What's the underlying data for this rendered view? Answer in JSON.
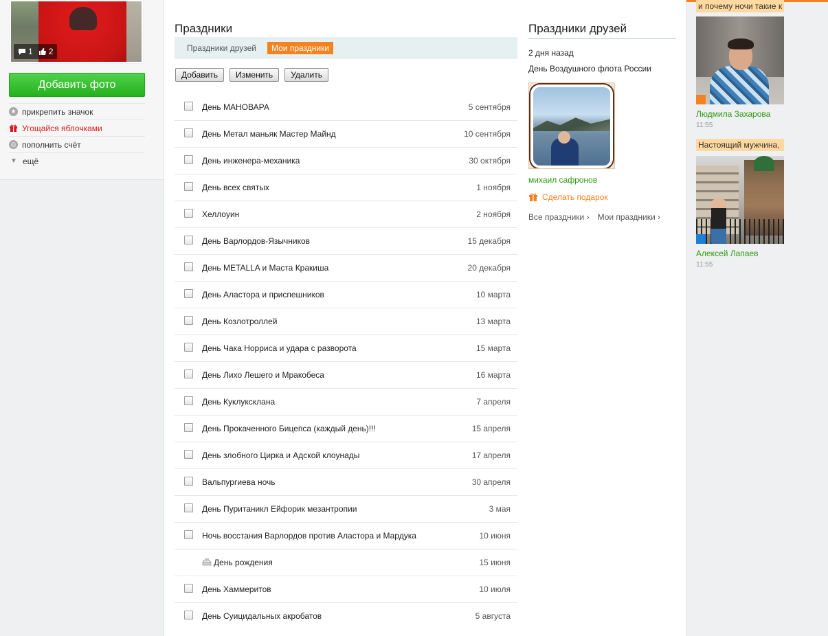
{
  "left": {
    "stats": {
      "comments": "1",
      "likes": "2"
    },
    "add_photo": "Добавить фото",
    "menu": [
      {
        "label": "прикрепить значок",
        "icon": "star-icon"
      },
      {
        "label": "Угощайся яблочками",
        "icon": "gift-icon",
        "color": "#d81a1a"
      },
      {
        "label": "пополнить счёт",
        "icon": "coins-icon"
      },
      {
        "label": "ещё",
        "icon": "triangle-down-icon"
      }
    ]
  },
  "holidays": {
    "title": "Праздники",
    "tabs": [
      {
        "label": "Праздники друзей",
        "active": false
      },
      {
        "label": "Мои праздники",
        "active": true
      }
    ],
    "actions": {
      "add": "Добавить",
      "edit": "Изменить",
      "delete": "Удалить"
    },
    "items": [
      {
        "name": "День МАНОВАРА",
        "date": "5 сентября"
      },
      {
        "name": "День Метал маньяк Мастер Майнд",
        "date": "10 сентября"
      },
      {
        "name": "День инженера-механика",
        "date": "30 октября"
      },
      {
        "name": "День всех святых",
        "date": "1 ноября"
      },
      {
        "name": "Хеллоуин",
        "date": "2 ноября"
      },
      {
        "name": "День Варлордов-Язычников",
        "date": "15 декабря"
      },
      {
        "name": "День METALLA и Маста Кракиша",
        "date": "20 декабря"
      },
      {
        "name": "День Аластора и приспешников",
        "date": "10 марта"
      },
      {
        "name": "День Козлотроллей",
        "date": "13 марта"
      },
      {
        "name": "День Чака Норриса и удара с разворота",
        "date": "15 марта"
      },
      {
        "name": "День Лихо Лешего и Мракобеса",
        "date": "16 марта"
      },
      {
        "name": "День Куклуксклана",
        "date": "7 апреля"
      },
      {
        "name": "День Прокаченного Бицепса  (каждый день)!!!",
        "date": "15 апреля"
      },
      {
        "name": "День злобного Цирка и Адской клоунады",
        "date": "17 апреля"
      },
      {
        "name": "Вальпургиева ночь",
        "date": "30 апреля"
      },
      {
        "name": "День Пуританикл Ейфорик мезантропии",
        "date": "3 мая"
      },
      {
        "name": "Ночь восстания Варлордов против Аластора и Мардука",
        "date": "10 июня"
      },
      {
        "name": "День рождения",
        "date": "15 июня",
        "birthday": true
      },
      {
        "name": "День Хаммеритов",
        "date": "10 июля"
      },
      {
        "name": "День  Суицидальных акробатов",
        "date": "5 августа"
      }
    ]
  },
  "friends_holidays": {
    "title": "Праздники друзей",
    "ago": "2 дня назад",
    "holiday": "День Воздушного флота России",
    "user": "михаил сафронов",
    "gift": "Сделать подарок",
    "links": {
      "all": "Все праздники ›",
      "mine": "Мои праздники ›"
    }
  },
  "feed": [
    {
      "message": "и почему ночи такие к",
      "name": "Людмила Захарова",
      "time": "11:55",
      "badge_color": "#f58220"
    },
    {
      "message": "Настоящий мужчина,",
      "name": "Алексей Лапаев",
      "time": "11:55",
      "badge_color": "#1e7fd6"
    }
  ]
}
